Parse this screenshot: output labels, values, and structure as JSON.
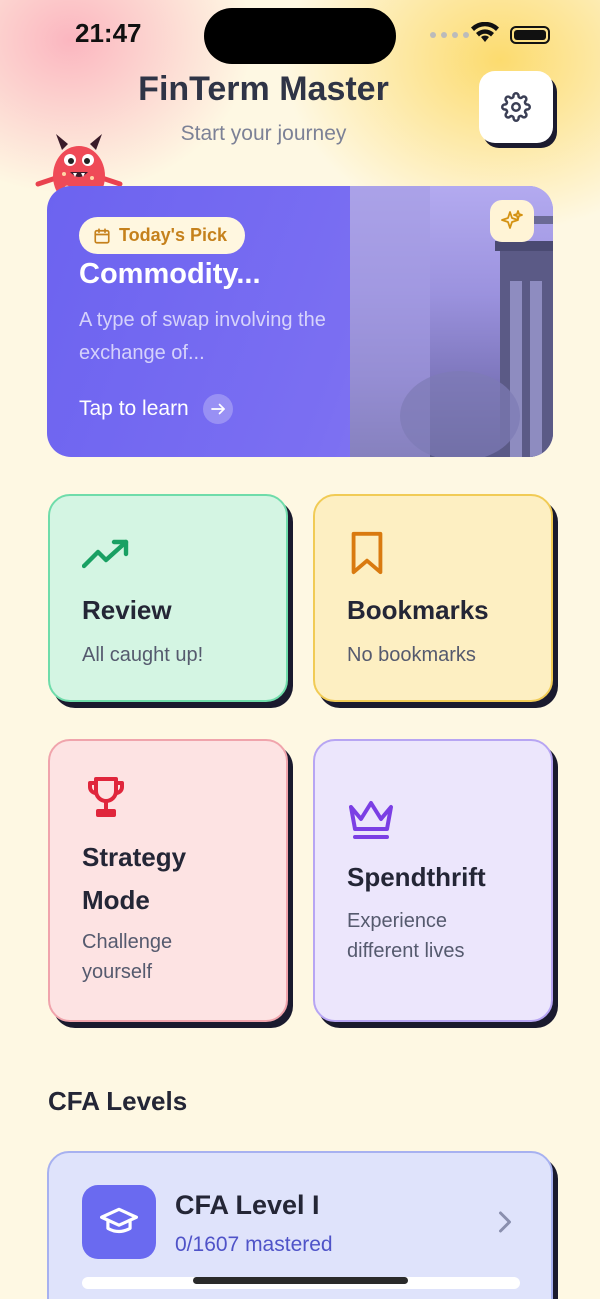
{
  "status_bar": {
    "time": "21:47"
  },
  "header": {
    "title": "FinTerm Master",
    "subtitle": "Start your journey",
    "settings_icon": "gear-icon"
  },
  "todays_pick": {
    "badge": "Today's Pick",
    "title": "Commodity...",
    "description": "A type of swap involving the exchange of...",
    "cta": "Tap to learn"
  },
  "features": {
    "review": {
      "title": "Review",
      "subtitle": "All caught up!",
      "icon": "trending-up-icon",
      "color": "#19a063"
    },
    "bookmarks": {
      "title": "Bookmarks",
      "subtitle": "No bookmarks",
      "icon": "bookmark-icon",
      "color": "#d97a10"
    },
    "strategy": {
      "title": "Strategy Mode",
      "subtitle": "Challenge yourself",
      "icon": "trophy-icon",
      "color": "#e0263c"
    },
    "spendthrift": {
      "title": "Spendthrift",
      "subtitle": "Experience different lives",
      "icon": "crown-icon",
      "color": "#7b3fe4"
    }
  },
  "cfa": {
    "section_title": "CFA Levels",
    "levels": [
      {
        "title": "CFA Level I",
        "progress_text": "0/1607 mastered",
        "progress": 0
      }
    ]
  }
}
